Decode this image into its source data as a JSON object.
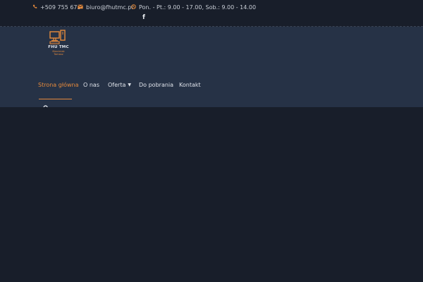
{
  "topbar": {
    "phone": "+509 755 673",
    "email": "biuro@fhutmc.pl",
    "hours": "Pon. - Pt.: 9.00 - 17.00, Sob.: 9.00 - 14.00",
    "social_icon": "facebook-icon",
    "facebook": "f"
  },
  "logo": {
    "title": "FHU TMC",
    "subtitle_line1": "Marciniak",
    "subtitle_line2": "Tomasz"
  },
  "nav": {
    "items": [
      {
        "label": "Strona główna",
        "active": true
      },
      {
        "label": "O nas"
      },
      {
        "label": "Oferta",
        "has_dropdown": true
      },
      {
        "label": "Do pobrania"
      },
      {
        "label": "Kontakt"
      }
    ]
  },
  "colors": {
    "accent": "#e58a3c",
    "header_bg": "#263246",
    "page_bg": "#181e2a"
  }
}
